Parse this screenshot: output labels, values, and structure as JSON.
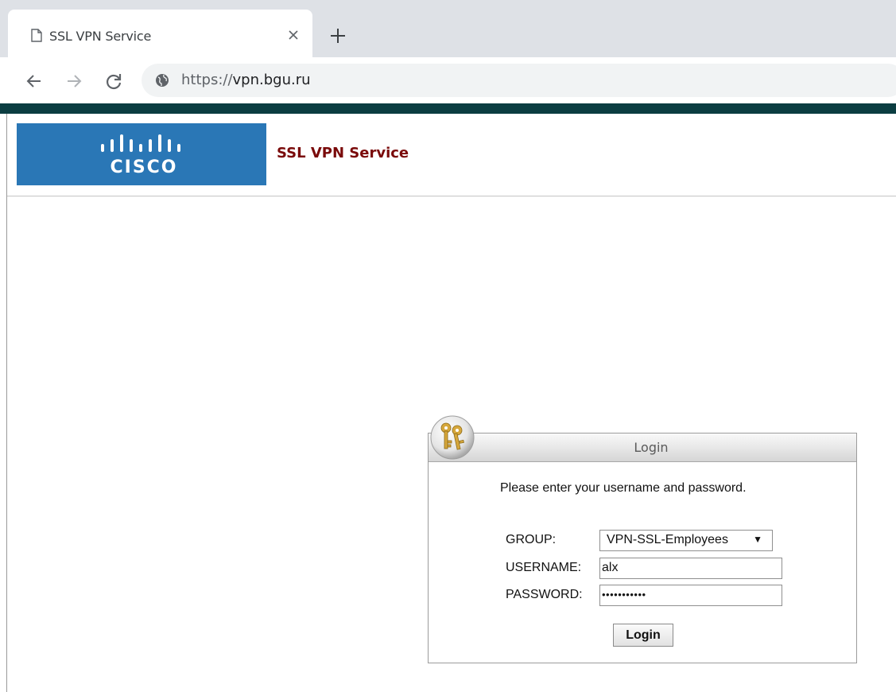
{
  "browser": {
    "tab_title": "SSL VPN Service",
    "url_scheme": "https://",
    "url_host": "vpn.bgu.ru"
  },
  "header": {
    "logo_text": "CISCO",
    "service_title": "SSL VPN Service"
  },
  "login": {
    "title": "Login",
    "instruction": "Please enter your username and password.",
    "group_label": "GROUP:",
    "group_value": "VPN-SSL-Employees",
    "username_label": "USERNAME:",
    "username_value": "alx",
    "password_label": "PASSWORD:",
    "password_mask": "•••••••••••",
    "button_label": "Login"
  },
  "colors": {
    "top_bar": "#0b3d41",
    "logo_background": "#2a77b6",
    "service_title": "#7a0a0a"
  },
  "icons": {
    "tab": "page-icon",
    "tab_close": "close-icon",
    "new_tab": "plus-icon",
    "back": "arrow-left-icon",
    "forward": "arrow-right-icon",
    "reload": "reload-icon",
    "site": "globe-icon",
    "login": "keys-icon"
  }
}
